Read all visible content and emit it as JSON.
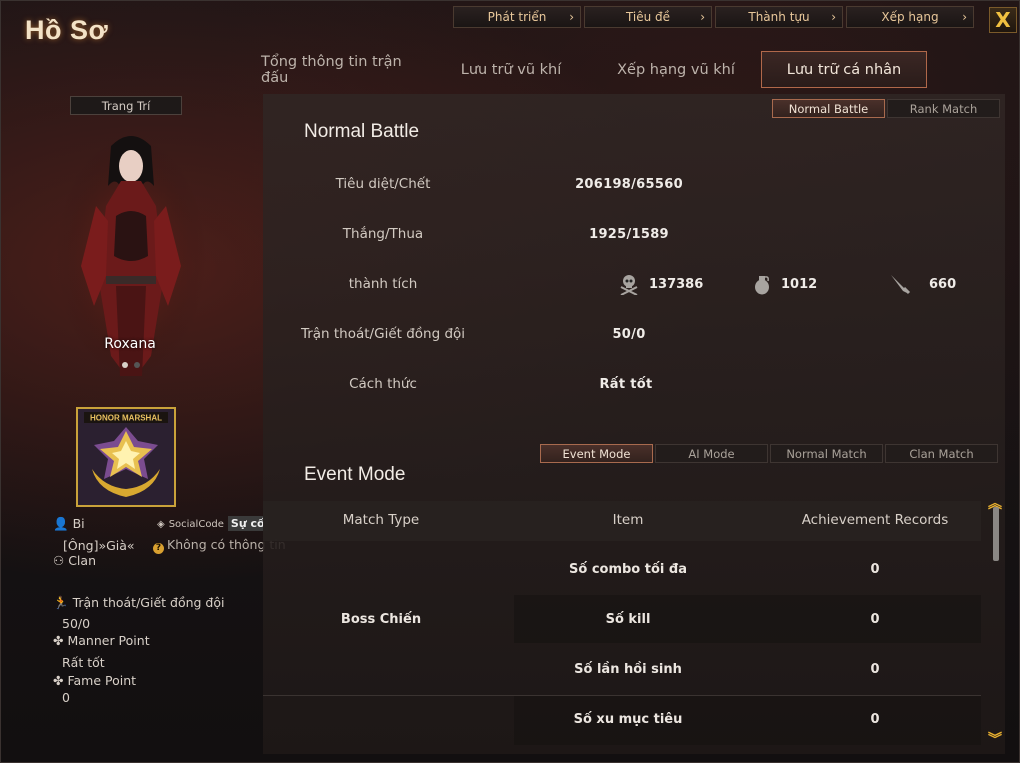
{
  "window": {
    "title": "Hồ Sơ"
  },
  "top_tabs": [
    {
      "label": "Phát triển"
    },
    {
      "label": "Tiêu đề"
    },
    {
      "label": "Thành tựu"
    },
    {
      "label": "Xếp hạng"
    }
  ],
  "close_label": "X",
  "main_tabs": [
    {
      "label": "Tổng thông tin trận đấu"
    },
    {
      "label": "Lưu trữ vũ khí"
    },
    {
      "label": "Xếp hạng vũ khí"
    },
    {
      "label": "Lưu trữ cá nhân",
      "active": true
    }
  ],
  "left": {
    "decorate_button": "Trang Trí",
    "character_name": "Roxana",
    "badge_text": "HONOR MARSHAL",
    "nickname": "Bi",
    "social_code_label": "SocialCode",
    "social_code_value": "Sự cố",
    "title_text": "[Ông]»Già«",
    "no_info_text": "Không có thông tin",
    "clan_label": "Clan",
    "desertion_label": "Trận thoát/Giết đồng đội",
    "desertion_value": "50/0",
    "manner_label": "Manner Point",
    "manner_value": "Rất tốt",
    "fame_label": "Fame Point",
    "fame_value": "0"
  },
  "normal_battle": {
    "title": "Normal Battle",
    "mode_buttons": [
      "Normal Battle",
      "Rank Match"
    ],
    "rows": [
      {
        "label": "Tiêu diệt/Chết",
        "value": "206198/65560"
      },
      {
        "label": "Thắng/Thua",
        "value": "1925/1589"
      },
      {
        "label": "thành tích",
        "value": ""
      },
      {
        "label": "Trận thoát/Giết đồng đội",
        "value": "50/0"
      },
      {
        "label": "Cách thức",
        "value": "Rất tốt"
      }
    ],
    "achievements": {
      "headshot": "137386",
      "grenade": "1012",
      "knife": "660"
    }
  },
  "event_mode": {
    "title": "Event Mode",
    "mode_buttons": [
      "Event Mode",
      "AI Mode",
      "Normal Match",
      "Clan Match"
    ],
    "headers": [
      "Match Type",
      "Item",
      "Achievement Records"
    ],
    "match_type": "Boss Chiến",
    "items": [
      {
        "item": "Số combo tối đa",
        "value": "0"
      },
      {
        "item": "Số kill",
        "value": "0"
      },
      {
        "item": "Số lần hồi sinh",
        "value": "0"
      },
      {
        "item": "Số xu mục tiêu",
        "value": "0"
      }
    ]
  }
}
